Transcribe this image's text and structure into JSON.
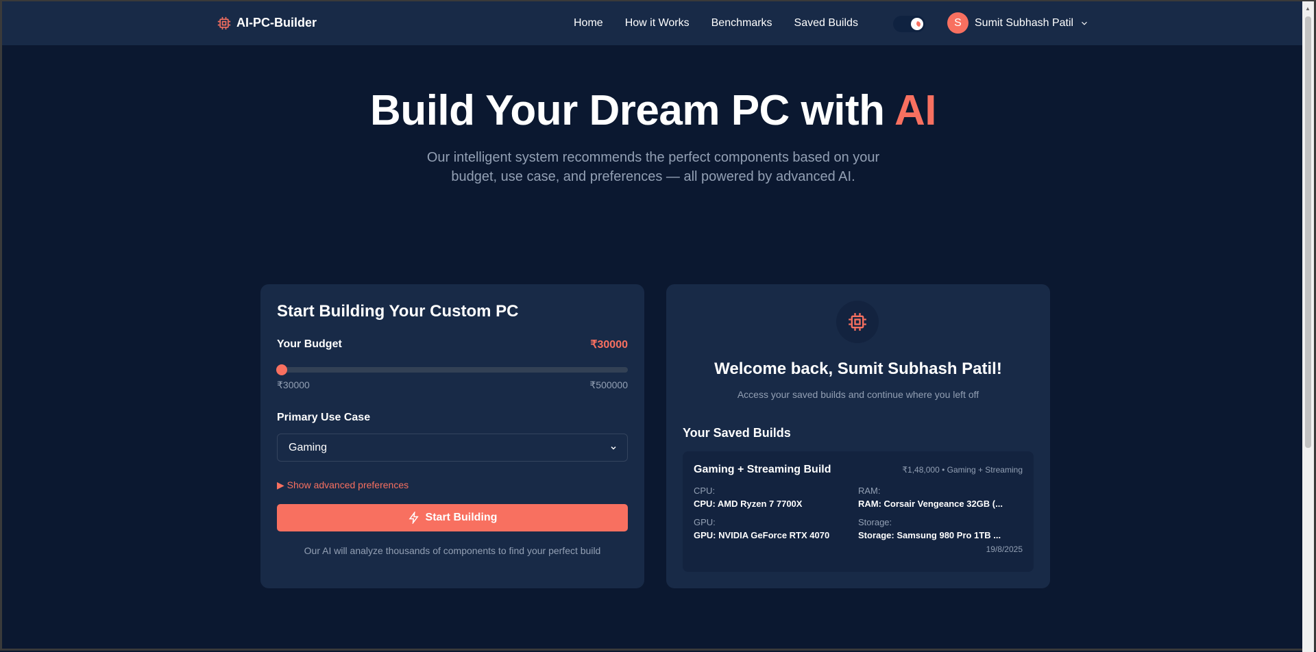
{
  "nav": {
    "logo": "AI-PC-Builder",
    "links": [
      "Home",
      "How it Works",
      "Benchmarks",
      "Saved Builds"
    ],
    "user_initial": "S",
    "user_name": "Sumit Subhash Patil"
  },
  "hero": {
    "title_main": "Build Your Dream PC with ",
    "title_accent": "AI",
    "subtitle_1": "Our intelligent system recommends the perfect components based on your",
    "subtitle_2": "budget, use case, and preferences — all powered by advanced AI."
  },
  "form": {
    "title": "Start Building Your Custom PC",
    "budget_label": "Your Budget",
    "budget_value": "₹30000",
    "budget_fraction": 0,
    "min": "₹30000",
    "max": "₹500000",
    "use_case_label": "Primary Use Case",
    "use_case": "Gaming",
    "advanced": "Show advanced preferences",
    "button": "Start Building",
    "footnote": "Our AI will analyze thousands of components to find your perfect build"
  },
  "welcome": {
    "title": "Welcome back, Sumit Subhash Patil!",
    "subtitle": "Access your saved builds and continue where you left off",
    "saved_heading": "Your Saved Builds",
    "builds": [
      {
        "name": "Gaming + Streaming Build",
        "meta": "₹1,48,000 • Gaming + Streaming",
        "cpu_label": "CPU:",
        "cpu": "CPU: AMD Ryzen 7 7700X",
        "ram_label": "RAM:",
        "ram": "RAM: Corsair Vengeance 32GB (...",
        "gpu_label": "GPU:",
        "gpu": "GPU: NVIDIA GeForce RTX 4070",
        "storage_label": "Storage:",
        "storage": "Storage: Samsung 980 Pro 1TB ...",
        "date": "19/8/2025"
      }
    ]
  },
  "colors": {
    "accent": "#f87060",
    "bg": "#0b1830",
    "card": "#182a47"
  }
}
